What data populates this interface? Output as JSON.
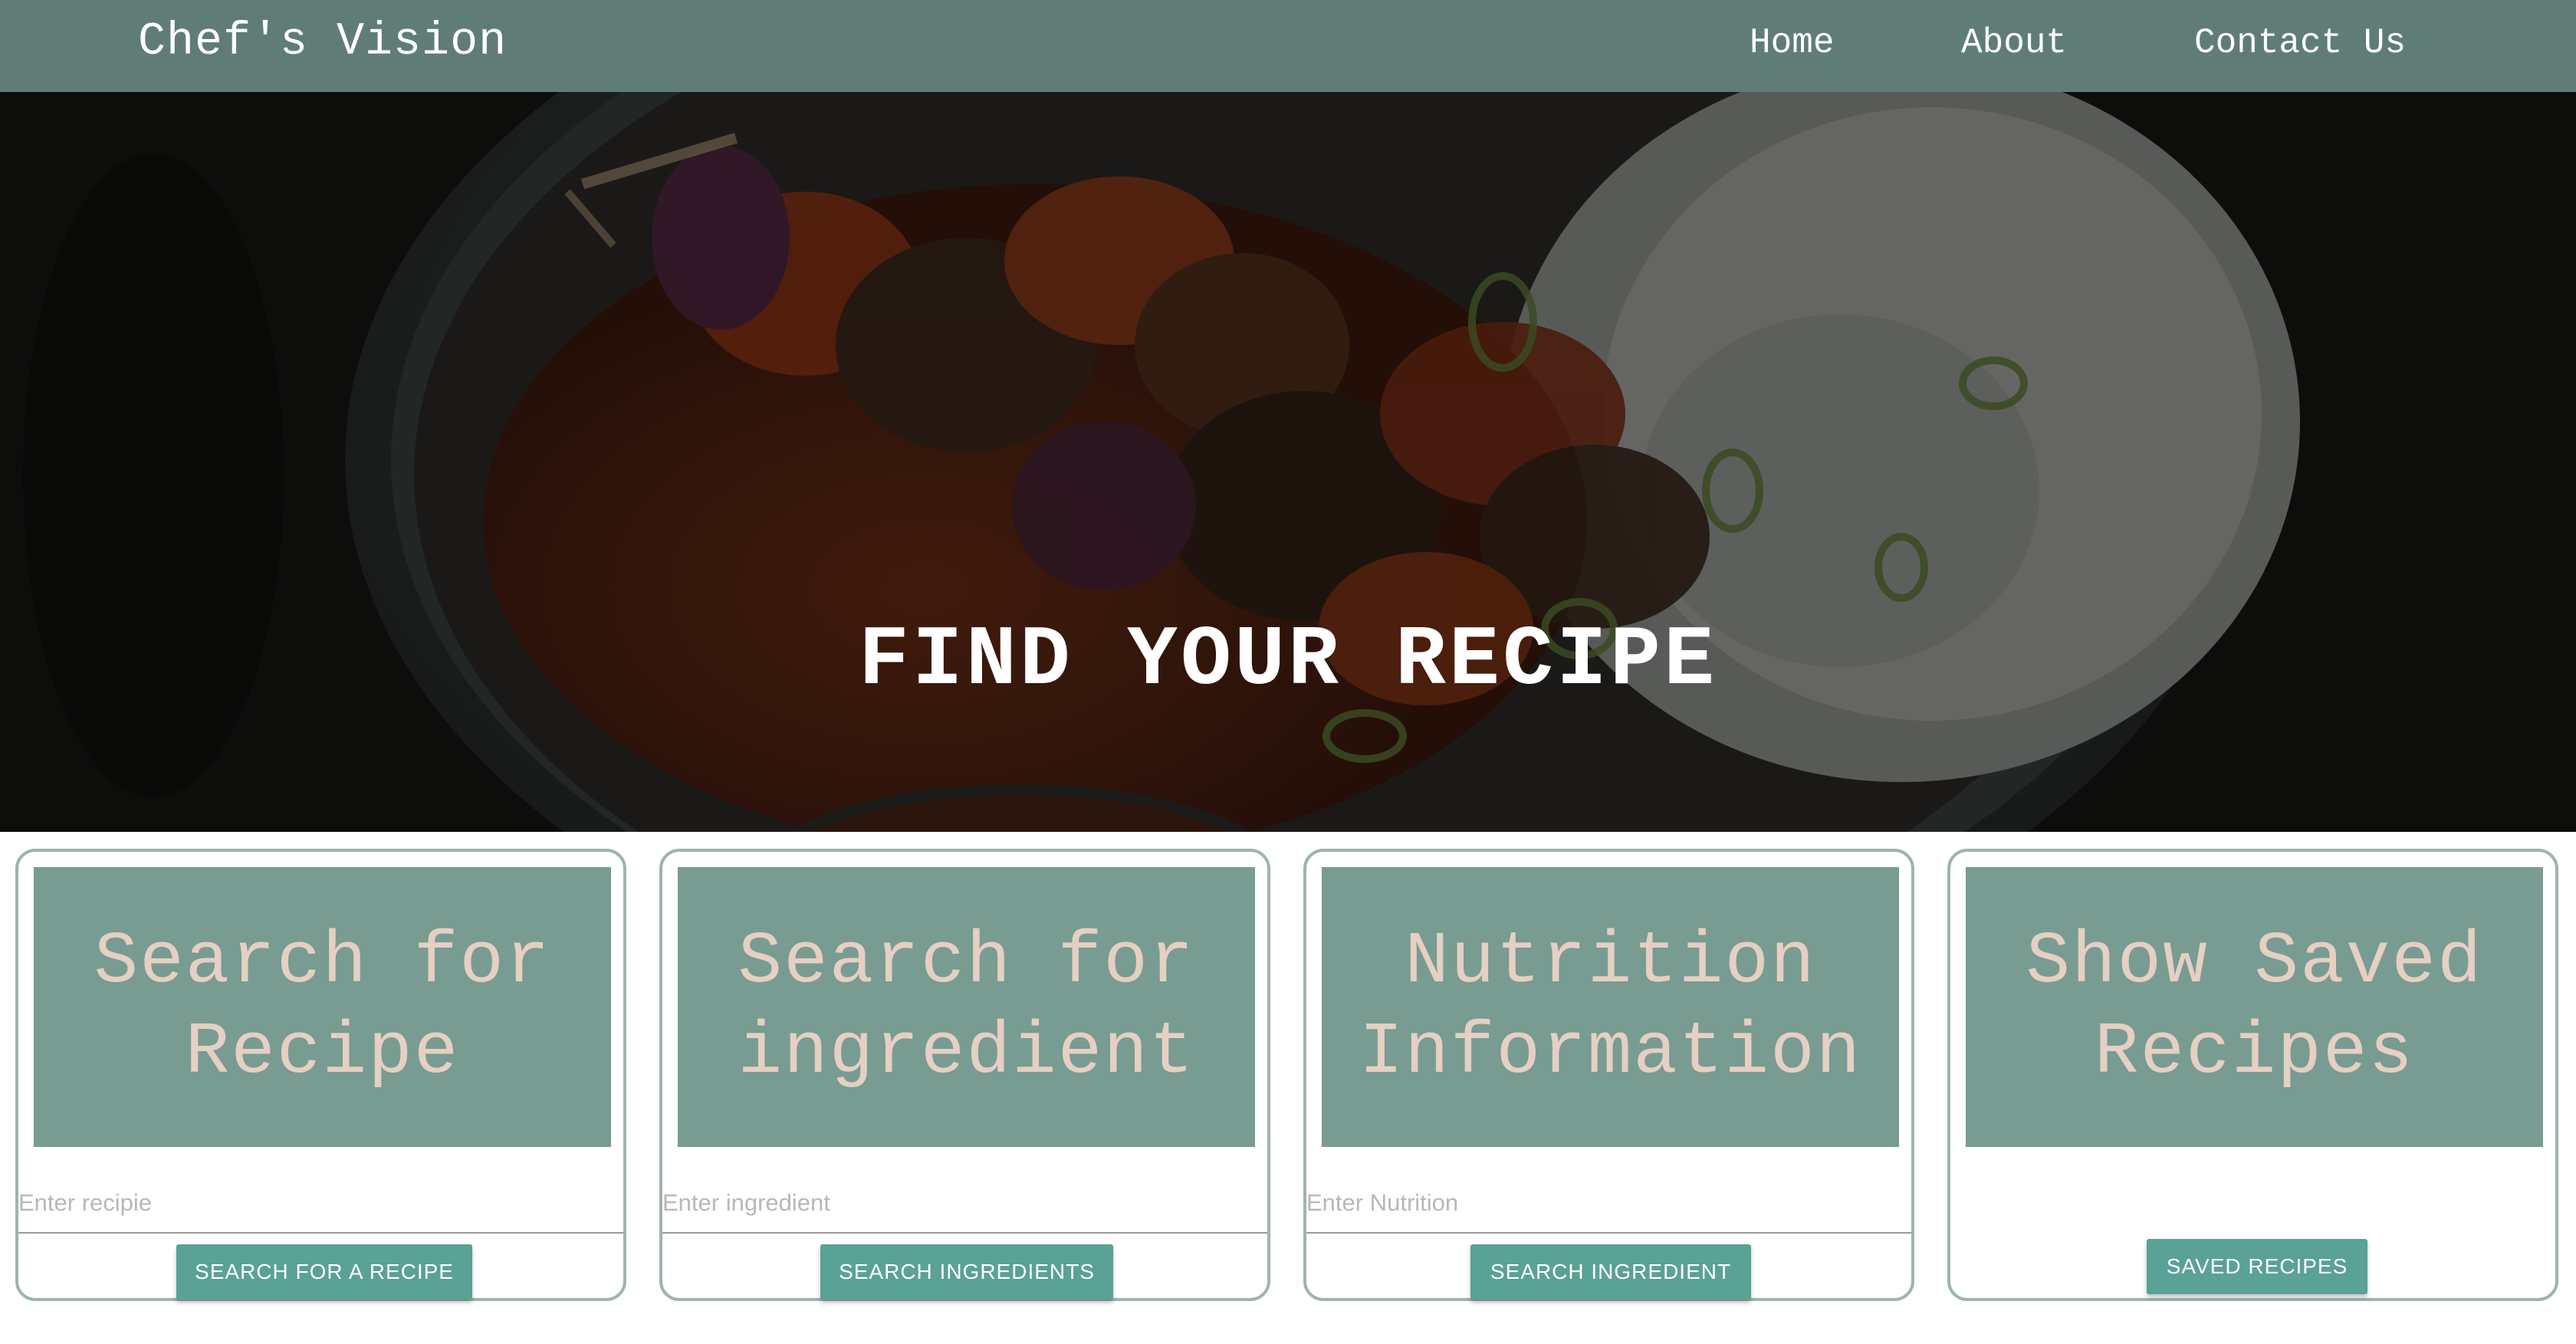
{
  "navbar": {
    "brand": "Chef's Vision",
    "links": [
      "Home",
      "About",
      "Contact Us"
    ],
    "background": "#5f7d76"
  },
  "hero": {
    "title": "FIND YOUR RECIPE",
    "image_description_icon": "food-bowl-background"
  },
  "cards": [
    {
      "title": "Search for Recipe",
      "placeholder": "Enter recipie",
      "button": "SEARCH FOR A RECIPE"
    },
    {
      "title": "Search for ingredient",
      "placeholder": "Enter ingredient",
      "button": "SEARCH INGREDIENTS"
    },
    {
      "title": "Nutrition Information",
      "placeholder": "Enter Nutrition",
      "button": "SEARCH INGREDIENT"
    },
    {
      "title": "Show Saved Recipes",
      "button": "SAVED RECIPES"
    }
  ],
  "colors": {
    "accent": "#5aa196",
    "card_header": "#789c92",
    "card_border": "#9cb5ae",
    "card_title_text": "#e6cfc3"
  }
}
